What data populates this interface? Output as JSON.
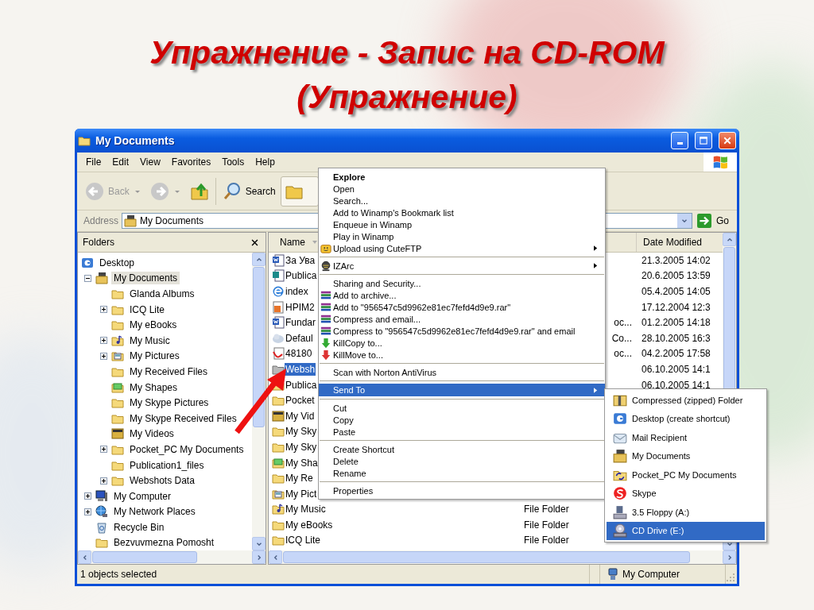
{
  "slide_title": [
    "Упражнение - Запис на CD-ROM",
    "(Упражнение)"
  ],
  "window": {
    "title": "My Documents"
  },
  "menu_bar": [
    "File",
    "Edit",
    "View",
    "Favorites",
    "Tools",
    "Help"
  ],
  "toolbar": {
    "back": {
      "label": "Back",
      "disabled": true
    },
    "search": {
      "label": "Search"
    }
  },
  "address_bar": {
    "label": "Address",
    "value": "My Documents",
    "go": "Go"
  },
  "folders_pane": {
    "title": "Folders",
    "tree": [
      {
        "label": "Desktop",
        "kind": "desktop",
        "expandable": false,
        "selected": false,
        "children": [
          {
            "label": "My Documents",
            "kind": "docs",
            "expandable": true,
            "expanded": true,
            "selected": true,
            "children": [
              {
                "label": "Glanda Albums",
                "kind": "folder",
                "expandable": false,
                "selected": false
              },
              {
                "label": "ICQ Lite",
                "kind": "folder",
                "expandable": true,
                "expanded": false,
                "selected": false
              },
              {
                "label": "My eBooks",
                "kind": "folder",
                "expandable": false,
                "selected": false
              },
              {
                "label": "My Music",
                "kind": "music",
                "expandable": true,
                "expanded": false,
                "selected": false
              },
              {
                "label": "My Pictures",
                "kind": "pictures",
                "expandable": true,
                "expanded": false,
                "selected": false
              },
              {
                "label": "My Received Files",
                "kind": "folder",
                "expandable": false,
                "selected": false
              },
              {
                "label": "My Shapes",
                "kind": "shapes",
                "expandable": false,
                "selected": false
              },
              {
                "label": "My Skype Pictures",
                "kind": "folder",
                "expandable": false,
                "selected": false
              },
              {
                "label": "My Skype Received Files",
                "kind": "folder",
                "expandable": false,
                "selected": false
              },
              {
                "label": "My Videos",
                "kind": "video",
                "expandable": false,
                "selected": false
              },
              {
                "label": "Pocket_PC My Documents",
                "kind": "folder",
                "expandable": true,
                "expanded": false,
                "selected": false
              },
              {
                "label": "Publication1_files",
                "kind": "folder",
                "expandable": false,
                "selected": false
              },
              {
                "label": "Webshots Data",
                "kind": "folder",
                "expandable": true,
                "expanded": false,
                "selected": false
              }
            ]
          },
          {
            "label": "My Computer",
            "kind": "computer",
            "expandable": true,
            "expanded": false,
            "selected": false
          },
          {
            "label": "My Network Places",
            "kind": "network",
            "expandable": true,
            "expanded": false,
            "selected": false
          },
          {
            "label": "Recycle Bin",
            "kind": "recycle",
            "expandable": false,
            "selected": false
          },
          {
            "label": "Bezvuvmezna Pomosht",
            "kind": "folder",
            "expandable": false,
            "selected": false
          }
        ]
      }
    ]
  },
  "file_list": {
    "columns": [
      "Name",
      "Date Modified"
    ],
    "rows": [
      {
        "name": "За Ува",
        "kind": "word",
        "date": "21.3.2005  14:02",
        "selected": false
      },
      {
        "name": "Publica",
        "kind": "publisher",
        "date": "20.6.2005  13:59",
        "selected": false
      },
      {
        "name": "index",
        "kind": "ie",
        "date": "05.4.2005  14:05",
        "selected": false
      },
      {
        "name": "HPIM2",
        "kind": "image",
        "date": "17.12.2004  12:3",
        "selected": false
      },
      {
        "name": "Fundar",
        "kind": "word",
        "type": "oc...",
        "type_cut_left": true,
        "date": "01.2.2005  14:18",
        "selected": false
      },
      {
        "name": "Defaul",
        "kind": "settings",
        "type": "Co...",
        "type_cut_left": true,
        "date": "28.10.2005  16:3",
        "selected": false
      },
      {
        "name": "48180",
        "kind": "pdf",
        "type": "oc...",
        "type_cut_left": true,
        "date": "04.2.2005  17:58",
        "selected": false
      },
      {
        "name": "Websh",
        "kind": "greyfolder",
        "date": "06.10.2005  14:1",
        "selected": true
      },
      {
        "name": "Publica",
        "kind": "folder",
        "date": "06.10.2005  14:1",
        "selected": false
      },
      {
        "name": "Pocket",
        "kind": "folder",
        "selected": false
      },
      {
        "name": "My Vid",
        "kind": "video",
        "selected": false
      },
      {
        "name": "My Sky",
        "kind": "folder",
        "selected": false
      },
      {
        "name": "My Sky",
        "kind": "folder",
        "selected": false
      },
      {
        "name": "My Sha",
        "kind": "shapes",
        "selected": false
      },
      {
        "name": "My Re",
        "kind": "folder",
        "selected": false
      },
      {
        "name": "My Pict",
        "kind": "pictures",
        "selected": false
      },
      {
        "name": "My Music",
        "kind": "music",
        "type": "File Folder",
        "type_cut_left": false,
        "selected": false
      },
      {
        "name": "My eBooks",
        "kind": "folder",
        "type": "File Folder",
        "type_cut_left": false,
        "selected": false
      },
      {
        "name": "ICQ Lite",
        "kind": "folder",
        "type": "File Folder",
        "type_cut_left": false,
        "selected": false
      }
    ]
  },
  "context_menu": [
    {
      "label": "Explore",
      "kind": "plain",
      "default": true,
      "submenu": false,
      "selected": false
    },
    {
      "label": "Open",
      "kind": "plain",
      "default": false,
      "submenu": false,
      "selected": false
    },
    {
      "label": "Search...",
      "kind": "plain",
      "default": false,
      "submenu": false,
      "selected": false
    },
    {
      "label": "Add to Winamp's Bookmark list",
      "kind": "plain",
      "default": false,
      "submenu": false,
      "selected": false
    },
    {
      "label": "Enqueue in Winamp",
      "kind": "plain",
      "default": false,
      "submenu": false,
      "selected": false
    },
    {
      "label": "Play in Winamp",
      "kind": "plain",
      "default": false,
      "submenu": false,
      "selected": false
    },
    {
      "label": "Upload using CuteFTP",
      "kind": "ftp",
      "default": false,
      "submenu": true,
      "selected": false
    },
    {
      "kind": "separator"
    },
    {
      "label": "IZArc",
      "kind": "izarc",
      "default": false,
      "submenu": true,
      "selected": false
    },
    {
      "kind": "separator"
    },
    {
      "label": "Sharing and Security...",
      "kind": "plain",
      "default": false,
      "submenu": false,
      "selected": false
    },
    {
      "label": "Add to archive...",
      "kind": "rar",
      "default": false,
      "submenu": false,
      "selected": false
    },
    {
      "label": "Add to \"956547c5d9962e81ec7fefd4d9e9.rar\"",
      "kind": "rar",
      "default": false,
      "submenu": false,
      "selected": false
    },
    {
      "label": "Compress and email...",
      "kind": "rar",
      "default": false,
      "submenu": false,
      "selected": false
    },
    {
      "label": "Compress to \"956547c5d9962e81ec7fefd4d9e9.rar\" and email",
      "kind": "rar",
      "default": false,
      "submenu": false,
      "selected": false
    },
    {
      "label": "KillCopy to...",
      "kind": "killcopy",
      "default": false,
      "submenu": false,
      "selected": false
    },
    {
      "label": "KillMove to...",
      "kind": "killmove",
      "default": false,
      "submenu": false,
      "selected": false
    },
    {
      "kind": "separator"
    },
    {
      "label": "Scan with Norton AntiVirus",
      "kind": "plain",
      "default": false,
      "submenu": false,
      "selected": false
    },
    {
      "kind": "separator"
    },
    {
      "label": "Send To",
      "kind": "plain",
      "default": false,
      "submenu": true,
      "selected": true
    },
    {
      "kind": "separator"
    },
    {
      "label": "Cut",
      "kind": "plain",
      "default": false,
      "submenu": false,
      "selected": false
    },
    {
      "label": "Copy",
      "kind": "plain",
      "default": false,
      "submenu": false,
      "selected": false
    },
    {
      "label": "Paste",
      "kind": "plain",
      "default": false,
      "submenu": false,
      "selected": false
    },
    {
      "kind": "separator"
    },
    {
      "label": "Create Shortcut",
      "kind": "plain",
      "default": false,
      "submenu": false,
      "selected": false
    },
    {
      "label": "Delete",
      "kind": "plain",
      "default": false,
      "submenu": false,
      "selected": false
    },
    {
      "label": "Rename",
      "kind": "plain",
      "default": false,
      "submenu": false,
      "selected": false
    },
    {
      "kind": "separator"
    },
    {
      "label": "Properties",
      "kind": "plain",
      "default": false,
      "submenu": false,
      "selected": false
    }
  ],
  "send_to_menu": [
    {
      "label": "Compressed (zipped) Folder",
      "kind": "zip",
      "selected": false
    },
    {
      "label": "Desktop (create shortcut)",
      "kind": "desktop",
      "selected": false
    },
    {
      "label": "Mail Recipient",
      "kind": "mail",
      "selected": false
    },
    {
      "label": "My Documents",
      "kind": "docs",
      "selected": false
    },
    {
      "label": "Pocket_PC My Documents",
      "kind": "sync",
      "selected": false
    },
    {
      "label": "Skype",
      "kind": "skype",
      "selected": false
    },
    {
      "label": "3.5 Floppy (A:)",
      "kind": "floppy",
      "selected": false
    },
    {
      "label": "CD Drive (E:)",
      "kind": "cd",
      "selected": true
    }
  ],
  "status_bar": [
    "1 objects selected",
    "My Computer"
  ]
}
